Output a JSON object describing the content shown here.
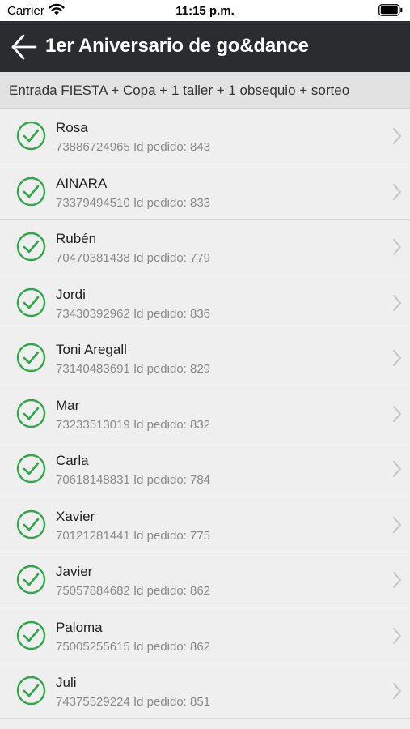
{
  "status": {
    "carrier": "Carrier",
    "time": "11:15 p.m."
  },
  "nav": {
    "title": "1er Aniversario de go&dance",
    "back_icon": "arrow-left-icon"
  },
  "section": {
    "header": "Entrada FIESTA + Copa + 1 taller + 1 obsequio + sorteo"
  },
  "colors": {
    "nav_background": "#2a2c2f",
    "check_green": "#2fa84a",
    "list_background": "#efefef"
  },
  "attendees": [
    {
      "name": "Rosa",
      "code": "73886724965",
      "order_label": "Id pedido:",
      "order_id": "843"
    },
    {
      "name": "AINARA",
      "code": "73379494510",
      "order_label": "Id pedido:",
      "order_id": "833"
    },
    {
      "name": "Rubén",
      "code": "70470381438",
      "order_label": "Id pedido:",
      "order_id": "779"
    },
    {
      "name": "Jordi",
      "code": "73430392962",
      "order_label": "Id pedido:",
      "order_id": "836"
    },
    {
      "name": "Toni Aregall",
      "code": "73140483691",
      "order_label": "Id pedido:",
      "order_id": "829"
    },
    {
      "name": "Mar",
      "code": "73233513019",
      "order_label": "Id pedido:",
      "order_id": "832"
    },
    {
      "name": "Carla",
      "code": "70618148831",
      "order_label": "Id pedido:",
      "order_id": "784"
    },
    {
      "name": "Xavier",
      "code": "70121281441",
      "order_label": "Id pedido:",
      "order_id": "775"
    },
    {
      "name": "Javier",
      "code": "75057884682",
      "order_label": "Id pedido:",
      "order_id": "862"
    },
    {
      "name": "Paloma",
      "code": "75005255615",
      "order_label": "Id pedido:",
      "order_id": "862"
    },
    {
      "name": "Juli",
      "code": "74375529224",
      "order_label": "Id pedido:",
      "order_id": "851"
    }
  ]
}
